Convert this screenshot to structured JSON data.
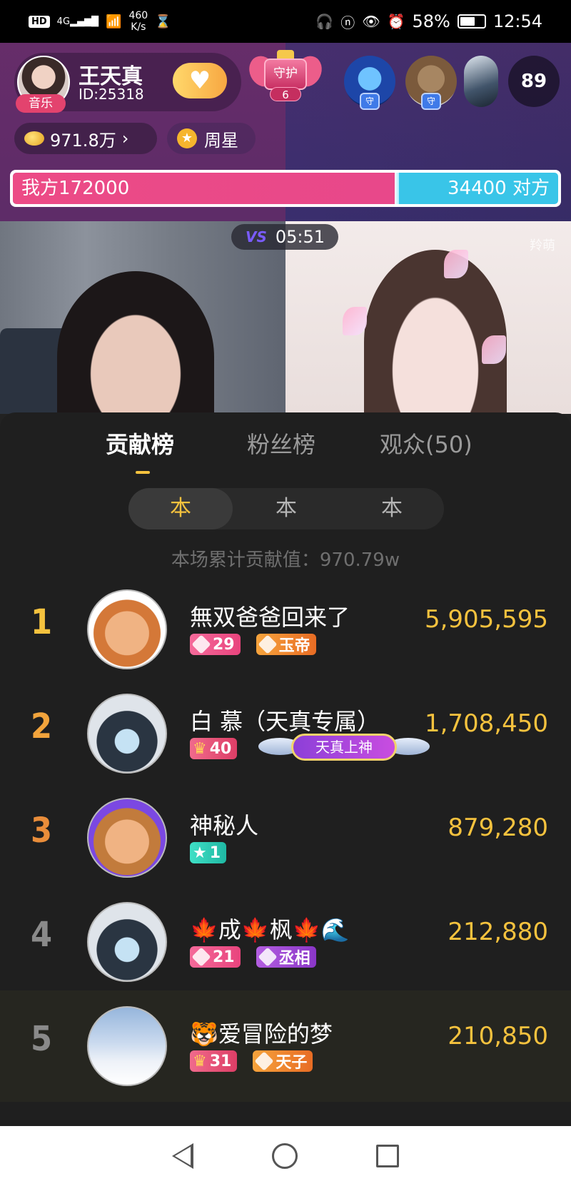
{
  "status_bar": {
    "hd": "HD",
    "net_type": "4G",
    "speed_value": "460",
    "speed_unit": "K/s",
    "battery": "58%",
    "time": "12:54"
  },
  "host": {
    "name": "王天真",
    "id": "ID:25318",
    "tag": "音乐"
  },
  "guard": {
    "label": "守护",
    "level": "6"
  },
  "viewers": {
    "guard_mark": "守",
    "count": "89"
  },
  "coins": {
    "value": "971.8万",
    "chevron": "›"
  },
  "weekly_star": {
    "label": "周星"
  },
  "pk": {
    "left_label": "我方172000",
    "right_label": "34400 对方",
    "left_value": 172000,
    "right_value": 34400,
    "left_fraction": 0.7
  },
  "video": {
    "vs_label": "VS",
    "timer": "05:51",
    "watermark": "羚萌"
  },
  "sheet": {
    "tabs": [
      "贡献榜",
      "粉丝榜",
      "观众(50)"
    ],
    "segments": [
      "本",
      "本",
      "本"
    ],
    "total_label": "本场累计贡献值：970.79w"
  },
  "leaderboard": [
    {
      "rank": "1",
      "name": "無双爸爸回来了",
      "badges": [
        {
          "text": "29",
          "kind": "gem"
        },
        {
          "text": "玉帝",
          "kind": "orange"
        }
      ],
      "score": "5,905,595"
    },
    {
      "rank": "2",
      "name": "白 慕（天真专属）",
      "badges": [
        {
          "text": "40",
          "kind": "crown"
        }
      ],
      "title_badge": "天真上神",
      "score": "1,708,450"
    },
    {
      "rank": "3",
      "name": "神秘人",
      "badges": [
        {
          "text": "1",
          "kind": "teal"
        }
      ],
      "score": "879,280"
    },
    {
      "rank": "4",
      "name": "🍁成🍁枫🍁🌊",
      "badges": [
        {
          "text": "21",
          "kind": "gem"
        },
        {
          "text": "丞相",
          "kind": "purple"
        }
      ],
      "score": "212,880"
    },
    {
      "rank": "5",
      "name": "🐯爱冒险的梦",
      "badges": [
        {
          "text": "31",
          "kind": "crown"
        },
        {
          "text": "天子",
          "kind": "orange"
        }
      ],
      "score": "210,850"
    }
  ],
  "colors": {
    "pk_pink": "#e8488a",
    "pk_cyan": "#39c5e8",
    "gold": "#f5c23e",
    "rank2": "#f2a43c",
    "rank3": "#e98d3a",
    "rank_other": "#8a8a8a"
  },
  "icons": {
    "status": [
      "hd-icon",
      "signal-icon",
      "wifi-icon",
      "hourglass-icon",
      "headset-icon",
      "nfc-icon",
      "eye-icon",
      "alarm-icon",
      "battery-icon"
    ],
    "nav": [
      "back-icon",
      "home-icon",
      "recents-icon"
    ]
  }
}
